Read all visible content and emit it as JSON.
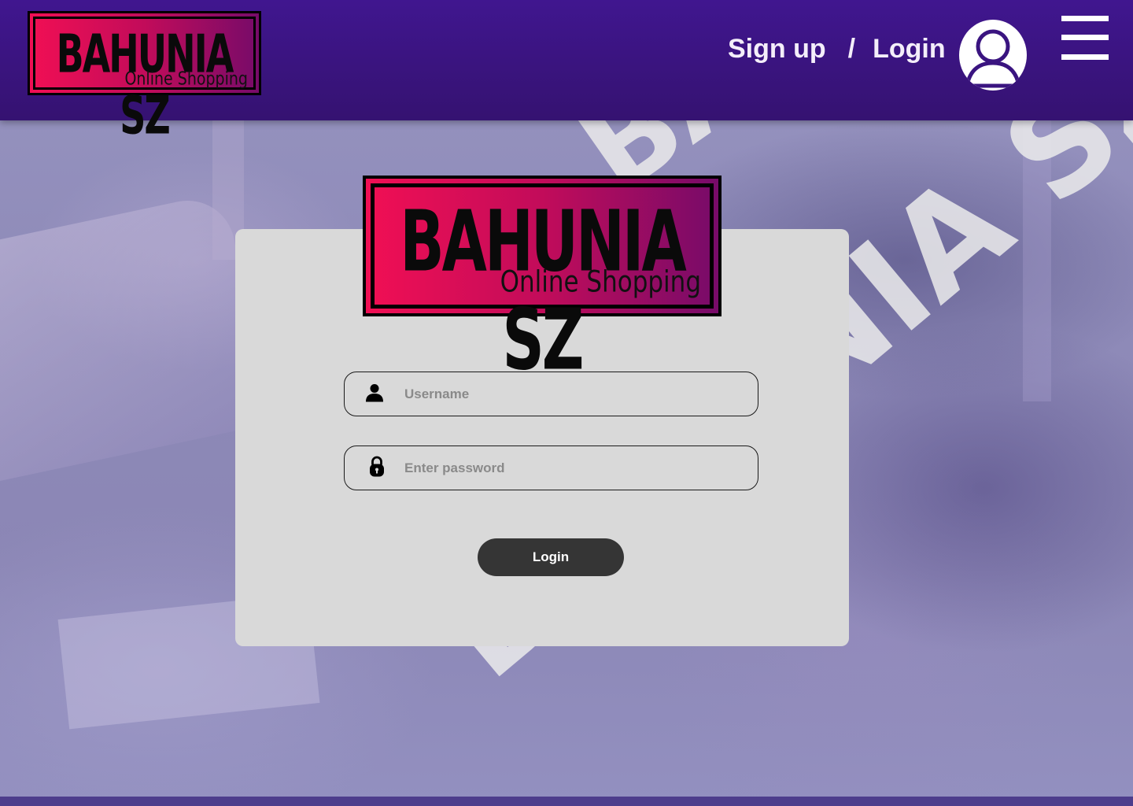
{
  "brand": {
    "title": "BAHUNIA SZ",
    "subtitle": "Online Shopping",
    "watermark": "BAHUNIA SZ"
  },
  "header": {
    "signup_label": "Sign up",
    "separator": "/",
    "login_label": "Login",
    "avatar_icon": "user-avatar-icon",
    "menu_icon": "hamburger-menu-icon"
  },
  "login_form": {
    "username": {
      "value": "",
      "placeholder": "Username",
      "icon": "user-icon"
    },
    "password": {
      "value": "",
      "placeholder": "Enter password",
      "icon": "lock-icon"
    },
    "submit_label": "Login"
  },
  "colors": {
    "header_bg": "#3a1480",
    "logo_gradient_start": "#f10f54",
    "logo_gradient_end": "#770b69",
    "card_bg": "#d9d9d9",
    "button_bg": "#353535"
  }
}
